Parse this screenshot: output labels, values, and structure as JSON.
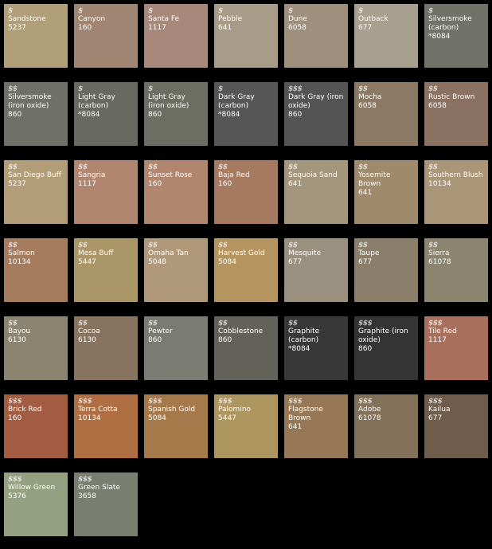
{
  "swatches": [
    {
      "price": "$",
      "name": "Sandstone",
      "code": "5237",
      "color": "#b09f79"
    },
    {
      "price": "$",
      "name": "Canyon",
      "code": "160",
      "color": "#a08672"
    },
    {
      "price": "$",
      "name": "Santa Fe",
      "code": "1117",
      "color": "#a8887a"
    },
    {
      "price": "$",
      "name": "Pebble",
      "code": "641",
      "color": "#a89b88"
    },
    {
      "price": "$",
      "name": "Dune",
      "code": "6058",
      "color": "#9e907c"
    },
    {
      "price": "$",
      "name": "Outback",
      "code": "677",
      "color": "#a8a08e"
    },
    {
      "price": "$",
      "name": "Silversmoke (carbon)",
      "code": "*8084",
      "color": "#71736b"
    },
    {
      "price": "$$",
      "name": "Silversmoke (iron oxide)",
      "code": "860",
      "color": "#6f7068"
    },
    {
      "price": "$",
      "name": "Light Gray (carbon)",
      "code": "*8084",
      "color": "#686960"
    },
    {
      "price": "$",
      "name": "Light Gray (iron oxide)",
      "code": "860",
      "color": "#6c6d63"
    },
    {
      "price": "$",
      "name": "Dark Gray (carbon)",
      "code": "*8084",
      "color": "#565656"
    },
    {
      "price": "$$$",
      "name": "Dark Gray (iron oxide)",
      "code": "860",
      "color": "#545454"
    },
    {
      "price": "$$",
      "name": "Mocha",
      "code": "6058",
      "color": "#8c7964"
    },
    {
      "price": "$$",
      "name": "Rustic Brown",
      "code": "6058",
      "color": "#8a7162"
    },
    {
      "price": "$$",
      "name": "San Diego Buff",
      "code": "5237",
      "color": "#b39c78"
    },
    {
      "price": "$$",
      "name": "Sangria",
      "code": "1117",
      "color": "#b08670"
    },
    {
      "price": "$$",
      "name": "Sunset Rose",
      "code": "160",
      "color": "#b0876e"
    },
    {
      "price": "$$",
      "name": "Baja Red",
      "code": "160",
      "color": "#a57a60"
    },
    {
      "price": "$$",
      "name": "Sequoia Sand",
      "code": "641",
      "color": "#a4967c"
    },
    {
      "price": "$$",
      "name": "Yosemite Brown",
      "code": "641",
      "color": "#9f8a6c"
    },
    {
      "price": "$$",
      "name": "Southern Blush",
      "code": "10134",
      "color": "#ab9578"
    },
    {
      "price": "$$",
      "name": "Salmon",
      "code": "10134",
      "color": "#a57c5d"
    },
    {
      "price": "$$",
      "name": "Mesa Buff",
      "code": "5447",
      "color": "#ab9668"
    },
    {
      "price": "$$",
      "name": "Omaha Tan",
      "code": "5048",
      "color": "#b0997a"
    },
    {
      "price": "$$",
      "name": "Harvest Gold",
      "code": "5084",
      "color": "#b5955f"
    },
    {
      "price": "$$",
      "name": "Mesquite",
      "code": "677",
      "color": "#99907f"
    },
    {
      "price": "$$",
      "name": "Taupe",
      "code": "677",
      "color": "#8b7e6b"
    },
    {
      "price": "$$",
      "name": "Sierra",
      "code": "61078",
      "color": "#8b8570"
    },
    {
      "price": "$$",
      "name": "Bayou",
      "code": "6130",
      "color": "#8a8470"
    },
    {
      "price": "$$",
      "name": "Cocoa",
      "code": "6130",
      "color": "#88735f"
    },
    {
      "price": "$$",
      "name": "Pewter",
      "code": "860",
      "color": "#7a7b72"
    },
    {
      "price": "$$",
      "name": "Cobblestone",
      "code": "860",
      "color": "#62625a"
    },
    {
      "price": "$$",
      "name": "Graphite (carbon)",
      "code": "*8084",
      "color": "#383838"
    },
    {
      "price": "$$$",
      "name": "Graphite (iron oxide)",
      "code": "860",
      "color": "#343434"
    },
    {
      "price": "$$$",
      "name": "Tile Red",
      "code": "1117",
      "color": "#a8705d"
    },
    {
      "price": "$$$",
      "name": "Brick Red",
      "code": "160",
      "color": "#a25c42"
    },
    {
      "price": "$$$",
      "name": "Terra Cotta",
      "code": "10134",
      "color": "#b06f42"
    },
    {
      "price": "$$$",
      "name": "Spanish Gold",
      "code": "5084",
      "color": "#a6794b"
    },
    {
      "price": "$$$",
      "name": "Palomino",
      "code": "5447",
      "color": "#ad9560"
    },
    {
      "price": "$$$",
      "name": "Flagstone Brown",
      "code": "641",
      "color": "#967856"
    },
    {
      "price": "$$$",
      "name": "Adobe",
      "code": "61078",
      "color": "#827059"
    },
    {
      "price": "$$$",
      "name": "Kailua",
      "code": "677",
      "color": "#6f5c4b"
    },
    {
      "price": "$$$",
      "name": "Willow Green",
      "code": "5376",
      "color": "#95a081"
    },
    {
      "price": "$$$",
      "name": "Green Slate",
      "code": "3658",
      "color": "#787e70"
    }
  ]
}
